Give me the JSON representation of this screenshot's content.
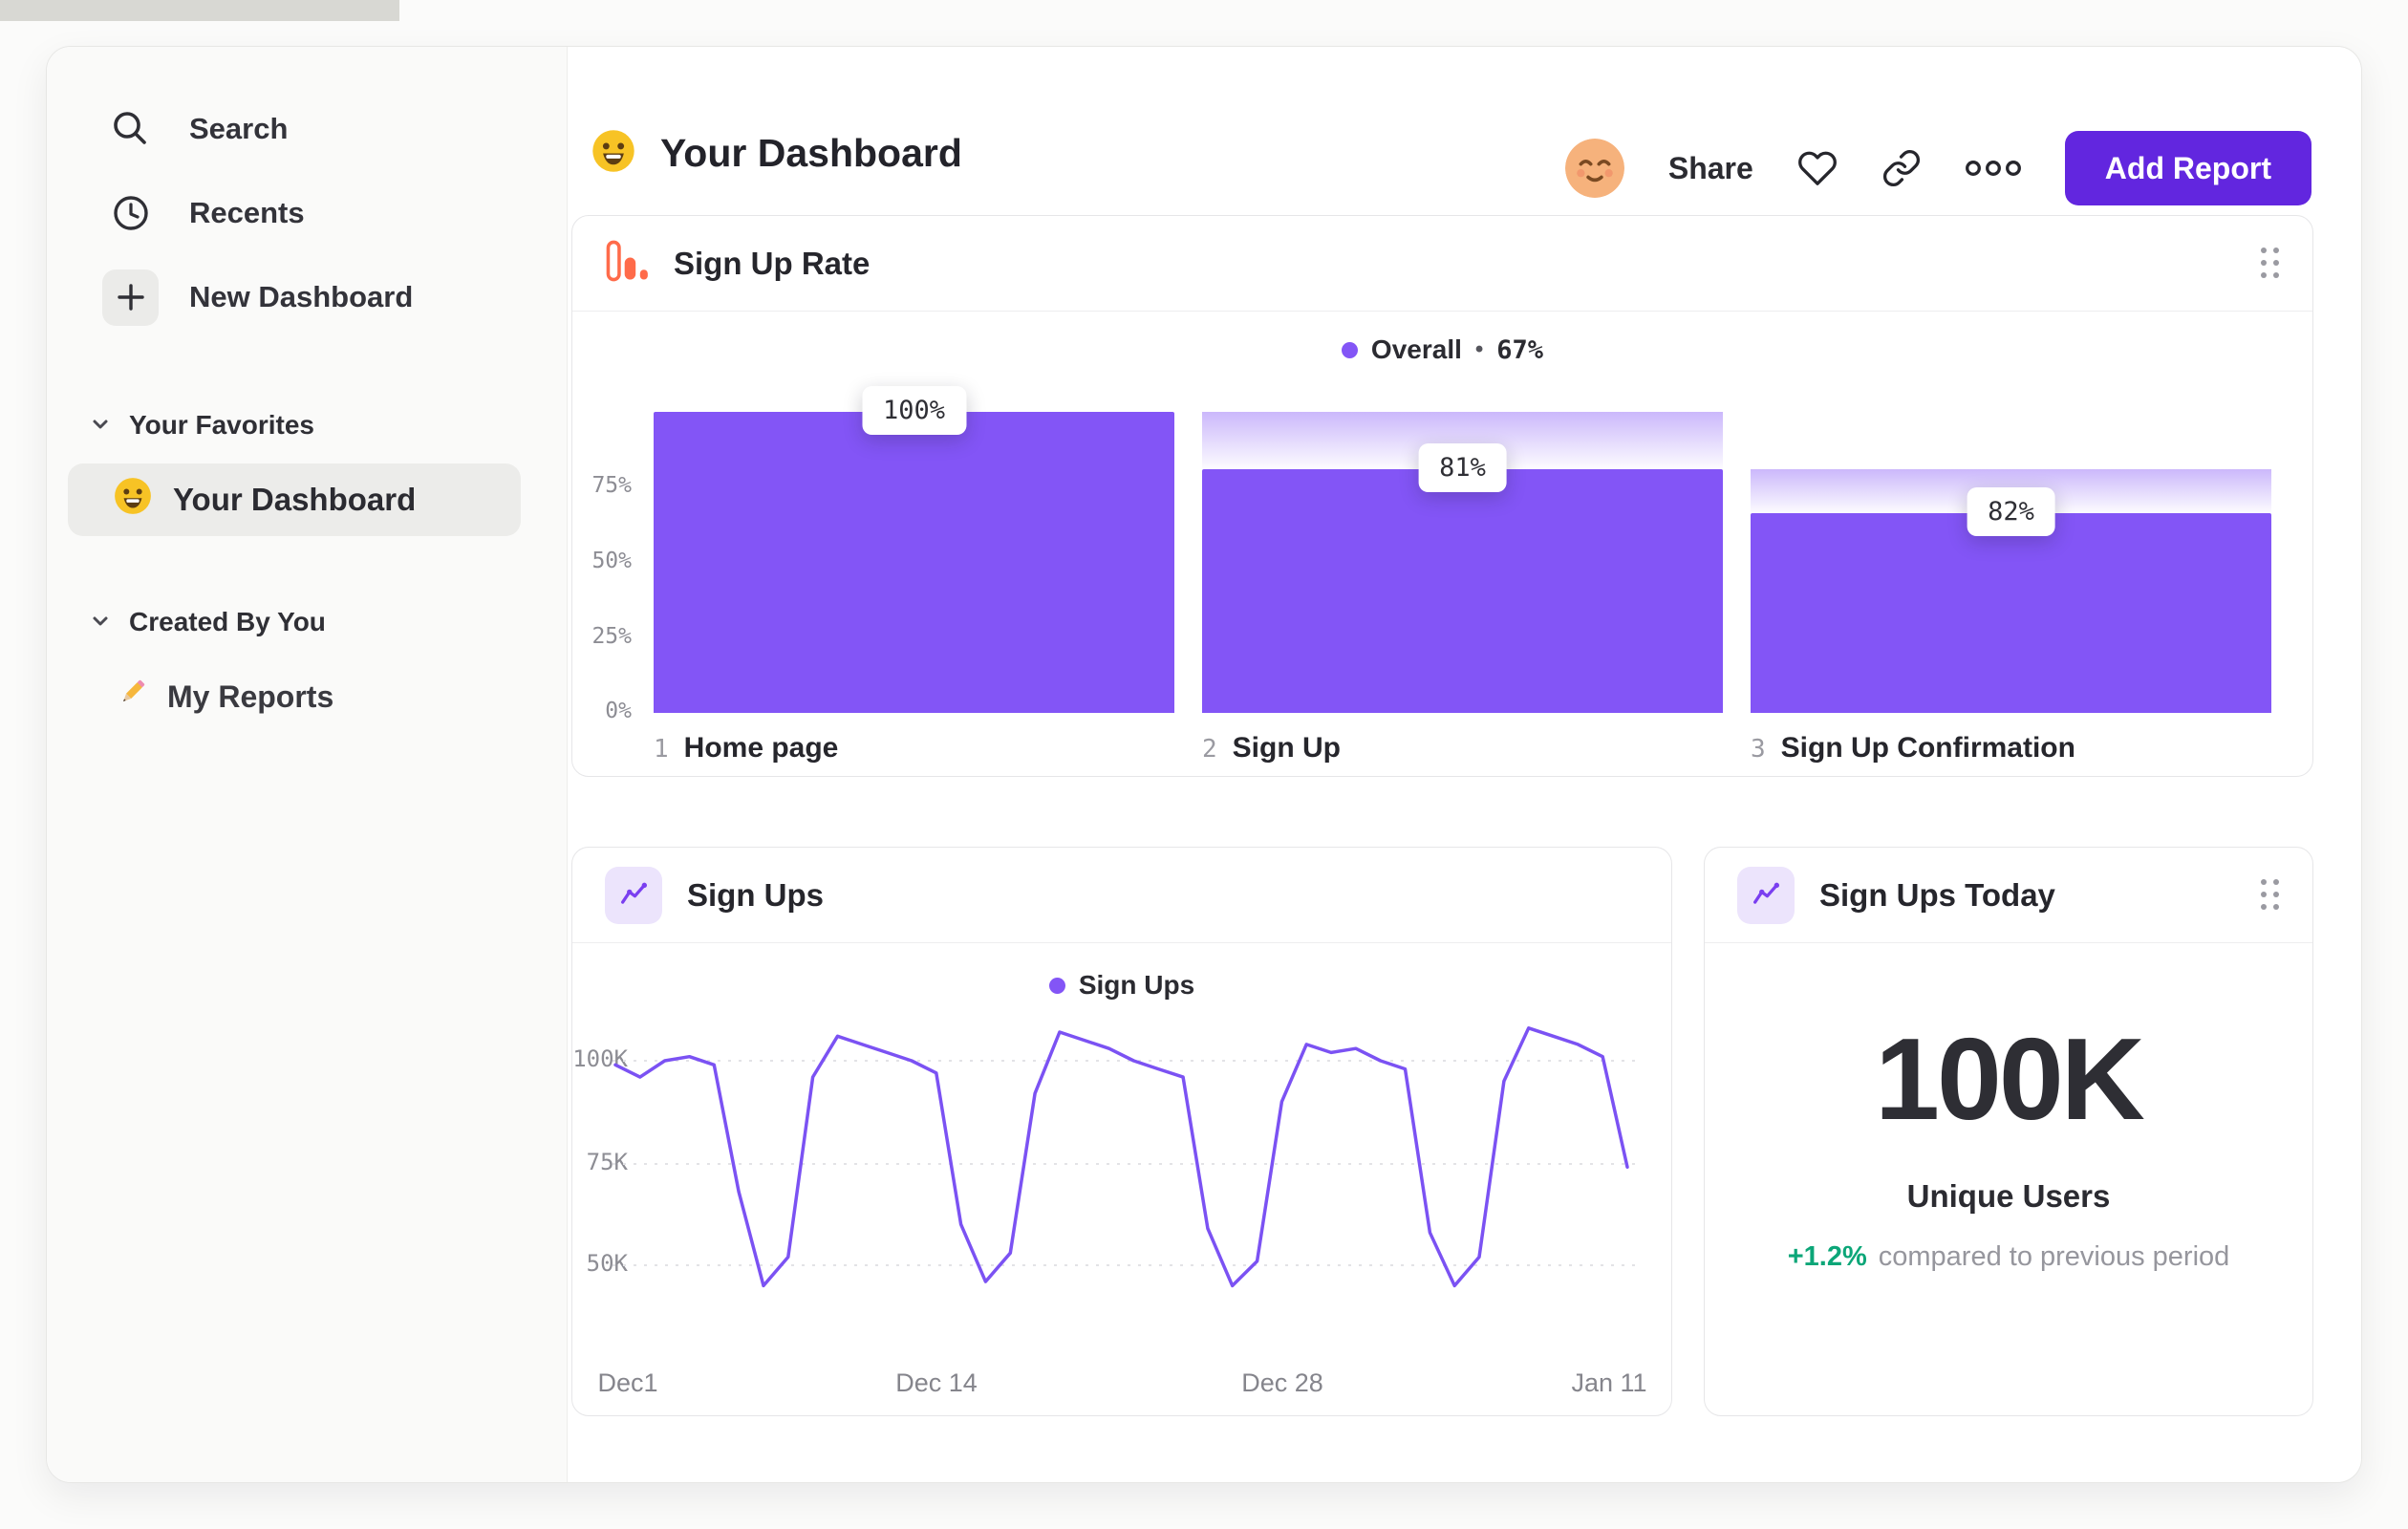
{
  "colors": {
    "accent_purple": "#6226df",
    "bar_purple": "#8355f6",
    "line_purple": "#7b52f3",
    "icon_orange": "#ff6b4a",
    "delta_green": "#0ca678",
    "selected_item_bg": "#ececea",
    "sidebar_bg": "#fafaf9"
  },
  "sidebar": {
    "items": [
      {
        "label": "Search",
        "icon": "search-icon"
      },
      {
        "label": "Recents",
        "icon": "clock-icon"
      },
      {
        "label": "New Dashboard",
        "icon": "plus-icon"
      }
    ],
    "sections": [
      {
        "title": "Your Favorites",
        "items": [
          {
            "label": "Your Dashboard",
            "icon": "smiley-icon",
            "selected": true
          }
        ]
      },
      {
        "title": "Created By You",
        "items": [
          {
            "label": "My Reports",
            "icon": "pencil-icon",
            "selected": false
          }
        ]
      }
    ]
  },
  "header": {
    "emoji_icon": "smiley-icon",
    "title": "Your Dashboard",
    "avatar_icon": "relieved-face-avatar",
    "share_label": "Share",
    "add_report_label": "Add Report"
  },
  "chart_data": [
    {
      "type": "bar",
      "title": "Sign Up Rate",
      "legend": {
        "label": "Overall",
        "separator": "•",
        "value": "67%"
      },
      "y_ticks": [
        "75%",
        "50%",
        "25%",
        "0%"
      ],
      "ylim": [
        0,
        100
      ],
      "steps": [
        {
          "num": "1",
          "name": "Home page",
          "label": "100%",
          "value": 100,
          "prev": 100
        },
        {
          "num": "2",
          "name": "Sign Up",
          "label": "81%",
          "value": 81,
          "prev": 100
        },
        {
          "num": "3",
          "name": "Sign Up Confirmation",
          "label": "82%",
          "value": 66.4,
          "prev": 81
        }
      ]
    },
    {
      "type": "line",
      "title": "Sign Ups",
      "legend": {
        "label": "Sign Ups"
      },
      "y_ticks": [
        "100K",
        "75K",
        "50K"
      ],
      "x_ticks": [
        "Dec1",
        "Dec 14",
        "Dec 28",
        "Jan 11"
      ],
      "unit": "K",
      "ylim": [
        40,
        112
      ],
      "values": [
        99,
        96,
        100,
        101,
        99,
        68,
        45,
        52,
        96,
        106,
        104,
        102,
        100,
        97,
        60,
        46,
        53,
        92,
        107,
        105,
        103,
        100,
        98,
        96,
        59,
        45,
        51,
        90,
        104,
        102,
        103,
        100,
        98,
        58,
        45,
        52,
        95,
        108,
        106,
        104,
        101,
        74
      ]
    },
    {
      "type": "big_number",
      "title": "Sign Ups Today",
      "value": "100K",
      "metric": "Unique Users",
      "delta": "+1.2%",
      "delta_note": "compared to previous period"
    }
  ]
}
